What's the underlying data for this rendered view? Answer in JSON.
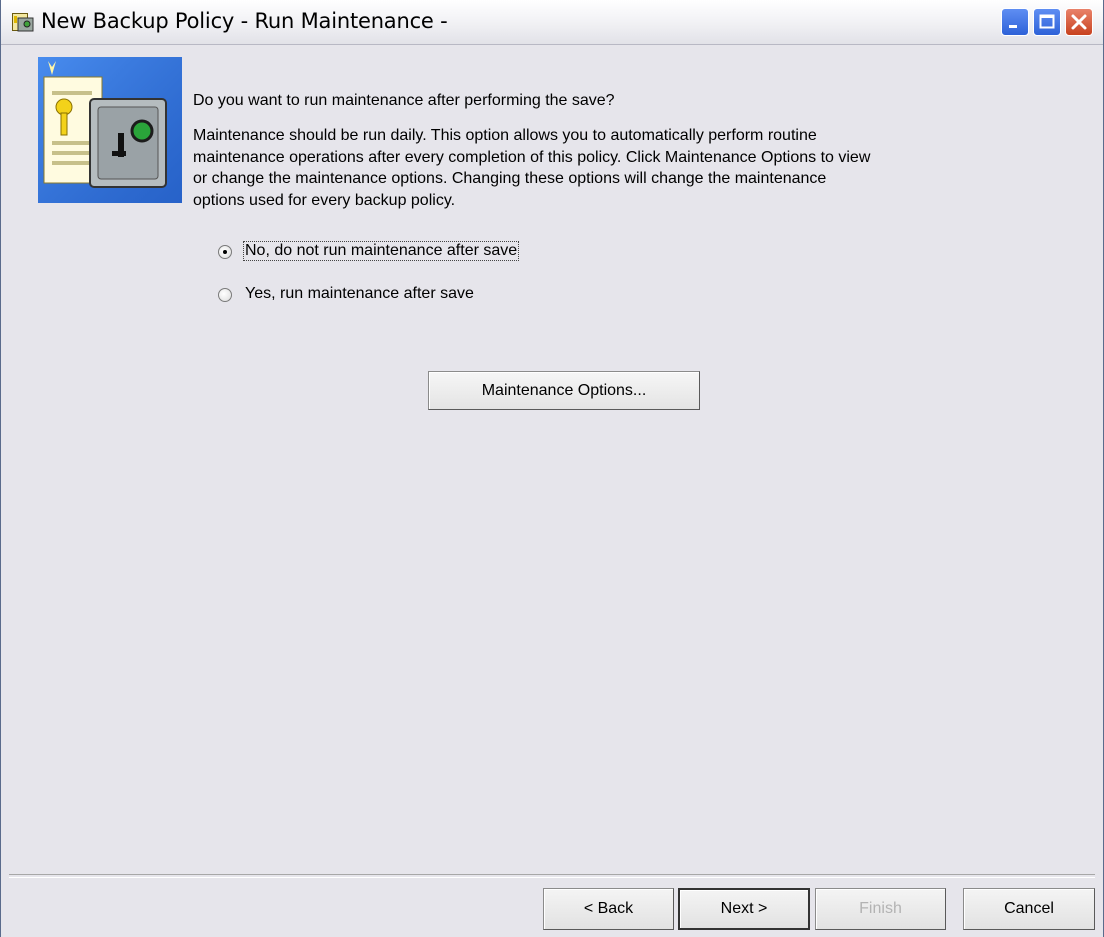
{
  "window": {
    "title": "New Backup Policy - Run Maintenance -",
    "icons": [
      "app-icon",
      "minimize-icon",
      "maximize-icon",
      "close-icon"
    ]
  },
  "content": {
    "question": "Do you want to run maintenance after performing the save?",
    "description_lines": [
      "Maintenance should be run daily.  This option allows you to automatically perform routine",
      "maintenance operations after every completion of this policy.  Click Maintenance Options to view",
      "or change the maintenance options.  Changing these options will change the maintenance",
      "options used for every backup policy."
    ],
    "options": [
      {
        "label": "No, do not run maintenance after save",
        "selected": true
      },
      {
        "label": "Yes, run maintenance after save",
        "selected": false
      }
    ],
    "maintenance_button": "Maintenance Options..."
  },
  "footer": {
    "back": "< Back",
    "next": "Next >",
    "finish": "Finish",
    "finish_enabled": false,
    "cancel": "Cancel"
  },
  "illustration": {
    "icon": "safe-document-icon"
  }
}
